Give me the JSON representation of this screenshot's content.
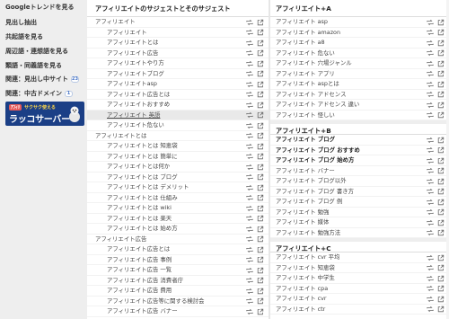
{
  "sidebar": {
    "items": [
      {
        "label": "Googleトレンドを見る"
      },
      {
        "label": "見出し抽出"
      },
      {
        "label": "共起語を見る"
      },
      {
        "label": "周辺語・連想語を見る"
      },
      {
        "label": "類語・同義語を見る"
      },
      {
        "label": "関連：見出し中サイト",
        "badge": "23"
      },
      {
        "label": "関連：中古ドメイン",
        "badge": "1"
      }
    ],
    "banner": {
      "tag": "ｱﾌｨﾘ",
      "subtitle": "サクサク使える",
      "title": "ラッコサーバー"
    }
  },
  "left_column": {
    "title": "アフィリエイトのサジェストとそのサジェスト",
    "rows": [
      {
        "text": "アフィリエイト",
        "level": 0
      },
      {
        "text": "アフィリエイト",
        "level": 1
      },
      {
        "text": "アフィリエイトとは",
        "level": 1
      },
      {
        "text": "アフィリエイト広告",
        "level": 1
      },
      {
        "text": "アフィリエイトやり方",
        "level": 1
      },
      {
        "text": "アフィリエイトブログ",
        "level": 1
      },
      {
        "text": "アフィリエイトasp",
        "level": 1
      },
      {
        "text": "アフィリエイト広告とは",
        "level": 1
      },
      {
        "text": "アフィリエイトおすすめ",
        "level": 1
      },
      {
        "text": "アフィリエイト 英語",
        "level": 1,
        "highlight": true
      },
      {
        "text": "アフィリエイト危ない",
        "level": 1
      },
      {
        "text": "アフィリエイトとは",
        "level": 0
      },
      {
        "text": "アフィリエイトとは 知恵袋",
        "level": 1
      },
      {
        "text": "アフィリエイトとは 簡単に",
        "level": 1
      },
      {
        "text": "アフィリエイトとは何か",
        "level": 1
      },
      {
        "text": "アフィリエイトとは ブログ",
        "level": 1
      },
      {
        "text": "アフィリエイトとは デメリット",
        "level": 1
      },
      {
        "text": "アフィリエイトとは 仕組み",
        "level": 1
      },
      {
        "text": "アフィリエイトとは wiki",
        "level": 1
      },
      {
        "text": "アフィリエイトとは 楽天",
        "level": 1
      },
      {
        "text": "アフィリエイトとは 始め方",
        "level": 1
      },
      {
        "text": "アフィリエイト広告",
        "level": 0
      },
      {
        "text": "アフィリエイト広告とは",
        "level": 1
      },
      {
        "text": "アフィリエイト広告 事例",
        "level": 1
      },
      {
        "text": "アフィリエイト広告 一覧",
        "level": 1
      },
      {
        "text": "アフィリエイト広告 消費者庁",
        "level": 1
      },
      {
        "text": "アフィリエイト広告 費用",
        "level": 1
      },
      {
        "text": "アフィリエイト広告等に関する検討会",
        "level": 1
      },
      {
        "text": "アフィリエイト広告 バナー",
        "level": 1
      }
    ]
  },
  "right_column": {
    "sections": [
      {
        "title": "アフィリエイト+A",
        "rows": [
          {
            "text": "アフィリエイト asp"
          },
          {
            "text": "アフィリエイト amazon"
          },
          {
            "text": "アフィリエイト a8"
          },
          {
            "text": "アフィリエイト 危ない"
          },
          {
            "text": "アフィリエイト 穴場ジャンル"
          },
          {
            "text": "アフィリエイト アプリ"
          },
          {
            "text": "アフィリエイト aspとは"
          },
          {
            "text": "アフィリエイト アドセンス"
          },
          {
            "text": "アフィリエイト アドセンス 違い"
          },
          {
            "text": "アフィリエイト 怪しい"
          }
        ]
      },
      {
        "title": "アフィリエイト+B",
        "rows": [
          {
            "text": "アフィリエイト ブログ",
            "bold": true
          },
          {
            "text": "アフィリエイト ブログ おすすめ",
            "bold": true
          },
          {
            "text": "アフィリエイト ブログ 始め方",
            "bold": true
          },
          {
            "text": "アフィリエイト バナー"
          },
          {
            "text": "アフィリエイト ブログ以外"
          },
          {
            "text": "アフィリエイト ブログ 書き方"
          },
          {
            "text": "アフィリエイト ブログ 例"
          },
          {
            "text": "アフィリエイト 勉強"
          },
          {
            "text": "アフィリエイト 媒体"
          },
          {
            "text": "アフィリエイト 勉強方法"
          }
        ]
      },
      {
        "title": "アフィリエイト+C",
        "rows": [
          {
            "text": "アフィリエイト cvr 平均"
          },
          {
            "text": "アフィリエイト 知恵袋"
          },
          {
            "text": "アフィリエイト 中学生"
          },
          {
            "text": "アフィリエイト cpa"
          },
          {
            "text": "アフィリエイト cvr"
          },
          {
            "text": "アフィリエイト ctr"
          }
        ]
      }
    ]
  },
  "icons": {
    "retweet": "retweet-icon",
    "external": "external-link-icon"
  },
  "colors": {
    "banner_bg": "#1b3f86",
    "banner_accent": "#ffd84a",
    "badge_border": "#b9c9e4"
  }
}
